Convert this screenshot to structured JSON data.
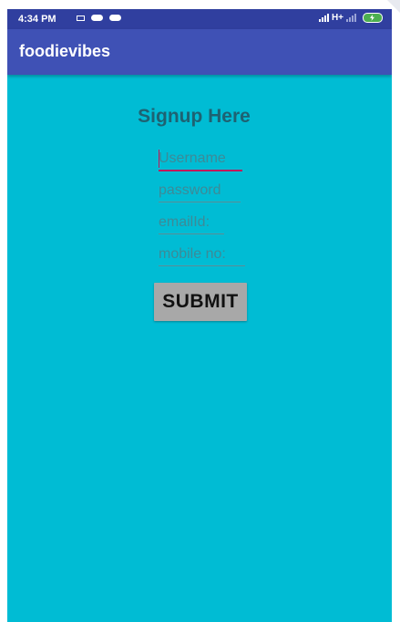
{
  "status_bar": {
    "time": "4:34 PM",
    "network": "H+",
    "battery_color": "#4caf50"
  },
  "app_bar": {
    "title": "foodievibes",
    "color": "#3f51b5"
  },
  "form": {
    "title": "Signup Here",
    "background": "#00bcd4",
    "username_placeholder": "Username",
    "password_placeholder": "password",
    "email_placeholder": "emailId:",
    "mobile_placeholder": "mobile no:",
    "submit_label": "SUBMIT"
  }
}
